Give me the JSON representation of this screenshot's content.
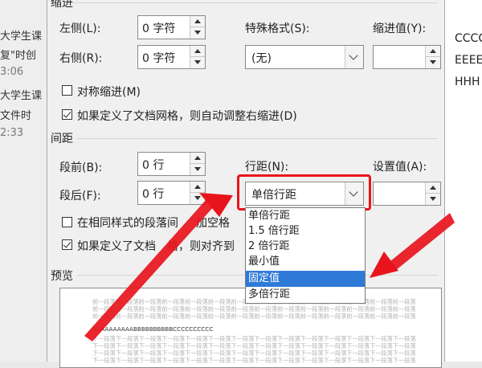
{
  "background_left": {
    "lines": [
      "大学生课",
      "复\"时创",
      "3:06",
      "大学生课",
      "文件时",
      "2:33"
    ]
  },
  "background_right": {
    "lines": [
      "CCCC",
      "EEEE",
      "HHH"
    ]
  },
  "indent": {
    "section_title": "缩进",
    "left_label": "左侧(L):",
    "left_value": "0 字符",
    "right_label": "右侧(R):",
    "right_value": "0 字符",
    "special_label": "特殊格式(S):",
    "special_value": "(无)",
    "indent_value_label": "缩进值(Y):",
    "indent_value": "",
    "mirror_label": "对称缩进(M)",
    "mirror_checked": false,
    "auto_adjust_label": "如果定义了文档网格，则自动调整右缩进(D)",
    "auto_adjust_checked": true
  },
  "spacing": {
    "section_title": "间距",
    "before_label": "段前(B):",
    "before_value": "0 行",
    "after_label": "段后(F):",
    "after_value": "0 行",
    "line_spacing_label": "行距(N):",
    "line_spacing_value": "单倍行距",
    "set_value_label": "设置值(A):",
    "set_value": "",
    "same_style_label": "在相同样式的段落间不添加空格",
    "same_style_label_visible": "在相同样式的段落间",
    "same_style_label_tail": "加空格",
    "same_style_checked": false,
    "grid_align_label": "如果定义了文档网格，则对齐到",
    "grid_align_visible_a": "如果定义了文档",
    "grid_align_visible_b": "格，则对齐到",
    "grid_align_checked": true,
    "options": [
      "单倍行距",
      "1.5 倍行距",
      "2 倍行距",
      "最小值",
      "固定值",
      "多倍行距"
    ],
    "highlighted_option": "固定值"
  },
  "preview": {
    "section_title": "预览",
    "prev_para_line": "前一段落前一段落前一段落前一段落前一段落前一段落前一段落前一段落前一段落前一段落前一段落前一段落前一段落前一段落",
    "sample_text": "AAAAAAAAAABBBBBBBBBBCCCCCCCCCC",
    "next_para_line": "下一段落下一段落下一段落下一段落下一段落下一段落下一段落下一段落下一段落下一段落下一段落下一段落下一段落下一段落"
  },
  "annotations": {
    "highlight_color": "#e8141c",
    "arrow_color": "#e8141c"
  }
}
